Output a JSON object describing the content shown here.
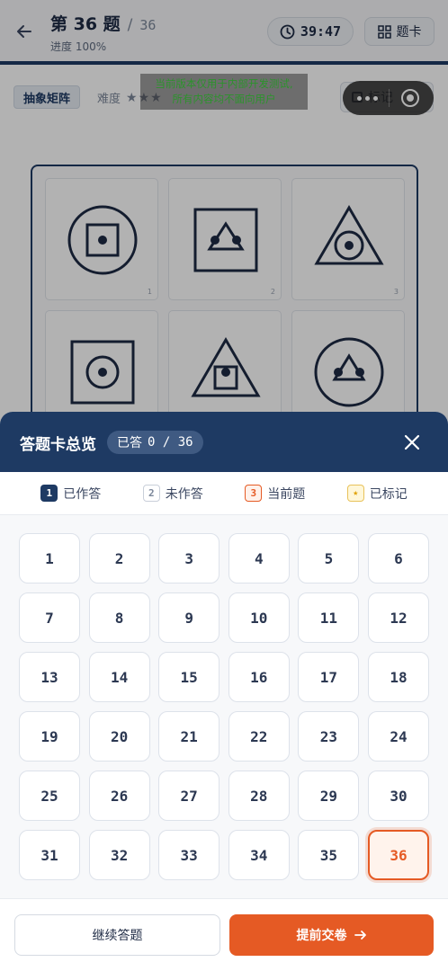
{
  "header": {
    "question_title": "第 36 题",
    "slash": "/",
    "total": "36",
    "progress": "进度 100%",
    "timer": "39:47",
    "answer_card_label": "题卡",
    "icons": [
      "back-arrow-icon",
      "clock-icon",
      "grid-icon"
    ]
  },
  "question": {
    "tag": "抽象矩阵",
    "difficulty_label": "难度",
    "difficulty_stars": "★★★",
    "mark_label": "标记",
    "matrix_cell_numbers": [
      "1",
      "2",
      "3"
    ]
  },
  "dev_notice": {
    "line1": "当前版本仅用于内部开发测试,",
    "line2": "所有内容均不面向用户"
  },
  "sheet": {
    "title": "答题卡总览",
    "answered_label": "已答",
    "answered_count": "0 / 36",
    "legend": [
      {
        "chip": "1",
        "label": "已作答",
        "kind": "done"
      },
      {
        "chip": "2",
        "label": "未作答",
        "kind": "todo"
      },
      {
        "chip": "3",
        "label": "当前题",
        "kind": "current"
      },
      {
        "chip": "★",
        "label": "已标记",
        "kind": "marked"
      }
    ],
    "questions": [
      "1",
      "2",
      "3",
      "4",
      "5",
      "6",
      "7",
      "8",
      "9",
      "10",
      "11",
      "12",
      "13",
      "14",
      "15",
      "16",
      "17",
      "18",
      "19",
      "20",
      "21",
      "22",
      "23",
      "24",
      "25",
      "26",
      "27",
      "28",
      "29",
      "30",
      "31",
      "32",
      "33",
      "34",
      "35",
      "36"
    ],
    "current_question": "36",
    "continue_label": "继续答题",
    "submit_label": "提前交卷"
  },
  "colors": {
    "primary": "#1e3a63",
    "accent": "#e55a24",
    "dev_notice_text": "#3fd23f"
  }
}
